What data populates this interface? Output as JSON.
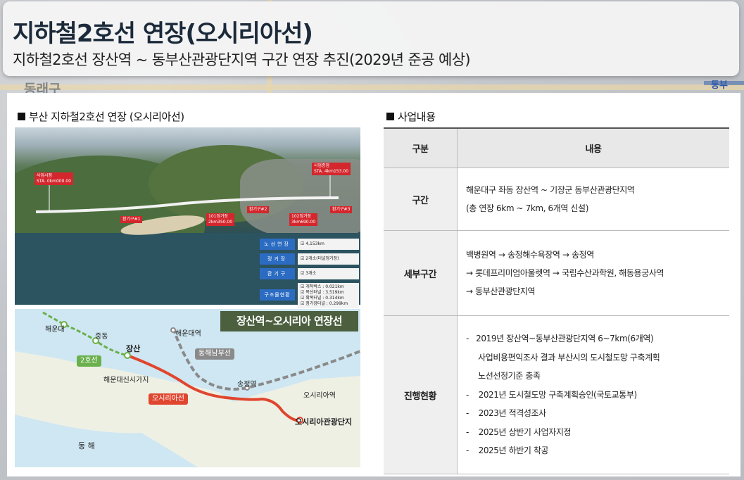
{
  "header": {
    "title": "지하철2호선 연장(오시리아선)",
    "subtitle": "지하철2호선 장산역 ~ 동부산관광단지역 구간 연장 추진(2029년 준공 예상)"
  },
  "background": {
    "label_left": "동래구",
    "label_right": "동부"
  },
  "left_section": {
    "title": "부산 지하철2호선 연장 (오시리아선)",
    "aerial": {
      "tags": {
        "start": "사업시점",
        "start_sta": "STA. 0km000.00",
        "end": "사업종점",
        "end_sta": "STA. 4km153.00",
        "station_101": "101정거장",
        "station_101_km": "2km350.00",
        "station_102": "102정거장",
        "station_102_km": "3km690.00",
        "vent1": "환기구#1",
        "vent2": "환기구#2",
        "vent3": "환기구#3"
      },
      "legend": [
        {
          "key": "노선연장",
          "value": "4,153km"
        },
        {
          "key": "정거장",
          "value": "2개소(터널정거장)"
        },
        {
          "key": "환기구",
          "value": "3개소"
        }
      ],
      "structure": {
        "key": "구조물현황",
        "items": [
          "개착박스 : 0.021km",
          "복선터널 : 3.519km",
          "확폭터널 : 0.314km",
          "정거장터널 : 0.299km"
        ]
      }
    },
    "routemap": {
      "title": "장산역~오시리아 연장선",
      "labels": {
        "haeundae": "해운대",
        "jungdong": "중동",
        "jangsan": "장산",
        "haeundae_station": "해운대역",
        "donghae_line": "동해남부선",
        "line2": "2호선",
        "new_city": "해운대신시가지",
        "songjeong": "송정역",
        "osiria_line": "오시리아선",
        "osiria_station": "오시리아역",
        "osiria_tour": "오시리아관광단지",
        "east_sea": "동  해"
      }
    }
  },
  "right_section": {
    "title": "사업내용",
    "table": {
      "headers": [
        "구분",
        "내용"
      ],
      "rows": [
        {
          "label": "구간",
          "lines": [
            "해운대구 좌동 장산역 ~ 기장군 동부산관광단지역",
            "(총 연장 6km ~ 7km, 6개역 신설)"
          ]
        },
        {
          "label": "세부구간",
          "lines": [
            "백병원역 → 송정해수욕장역 → 송정역",
            "→ 롯데프리미엄아울렛역 → 국립수산과학원, 해동용궁사역",
            "→ 동부산관광단지역"
          ]
        },
        {
          "label": "진행현황",
          "lines": [
            "-   2019년 장산역~동부산관광단지역 6~7km(6개역)",
            "     사업비용편익조사 결과 부산시의 도시철도망 구축계획",
            "     노선선정기준 충족",
            "-    2021년 도시철도망 구축계획승인(국토교통부)",
            "-    2023년 적격성조사",
            "-    2025년 상반기 사업자지정",
            "-    2025년 하반기 착공"
          ]
        }
      ]
    }
  },
  "colors": {
    "route_red": "#e0462f",
    "line2_green": "#6ab04c",
    "legend_blue": "#2b6cc2",
    "map_title_bg": "#4c5f3f"
  }
}
